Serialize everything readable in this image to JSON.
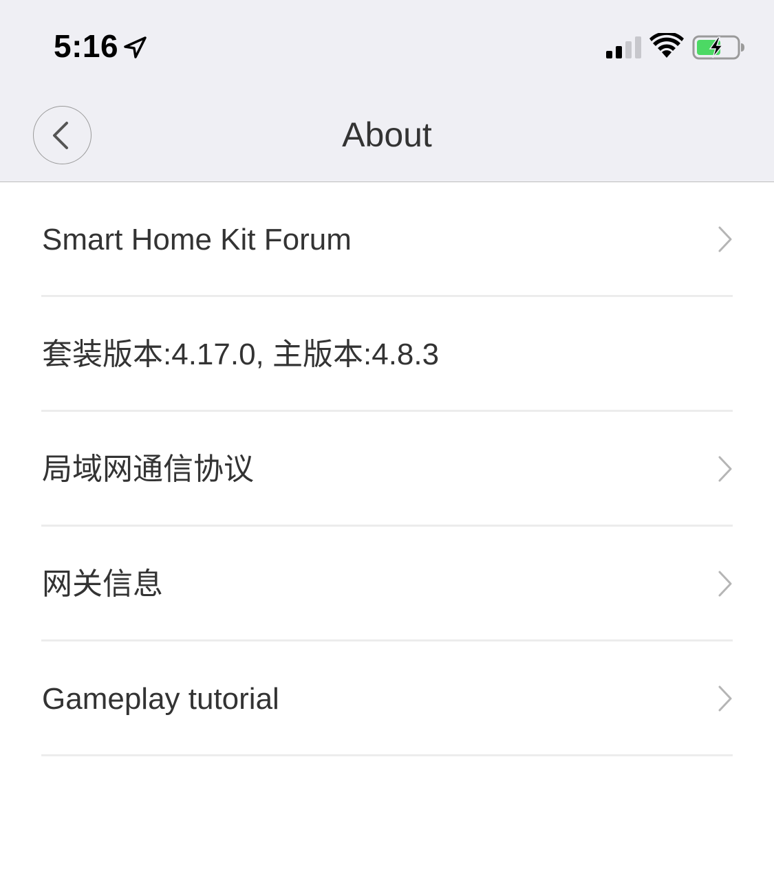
{
  "status_bar": {
    "time": "5:16",
    "icons": [
      "location-arrow-icon",
      "cellular-signal-icon",
      "wifi-icon",
      "battery-charging-icon"
    ],
    "battery_color": "#4cd964"
  },
  "nav": {
    "title": "About",
    "back_icon": "chevron-left-icon"
  },
  "items": [
    {
      "label": "Smart Home Kit Forum",
      "has_chevron": true
    },
    {
      "label": "套装版本:4.17.0, 主版本:4.8.3",
      "has_chevron": false
    },
    {
      "label": "局域网通信协议",
      "has_chevron": true
    },
    {
      "label": "网关信息",
      "has_chevron": true
    },
    {
      "label": "Gameplay tutorial",
      "has_chevron": true
    }
  ],
  "colors": {
    "header_bg": "#efeff4",
    "divider": "#ececec",
    "text": "#333333",
    "chevron": "#b5b5b5"
  }
}
